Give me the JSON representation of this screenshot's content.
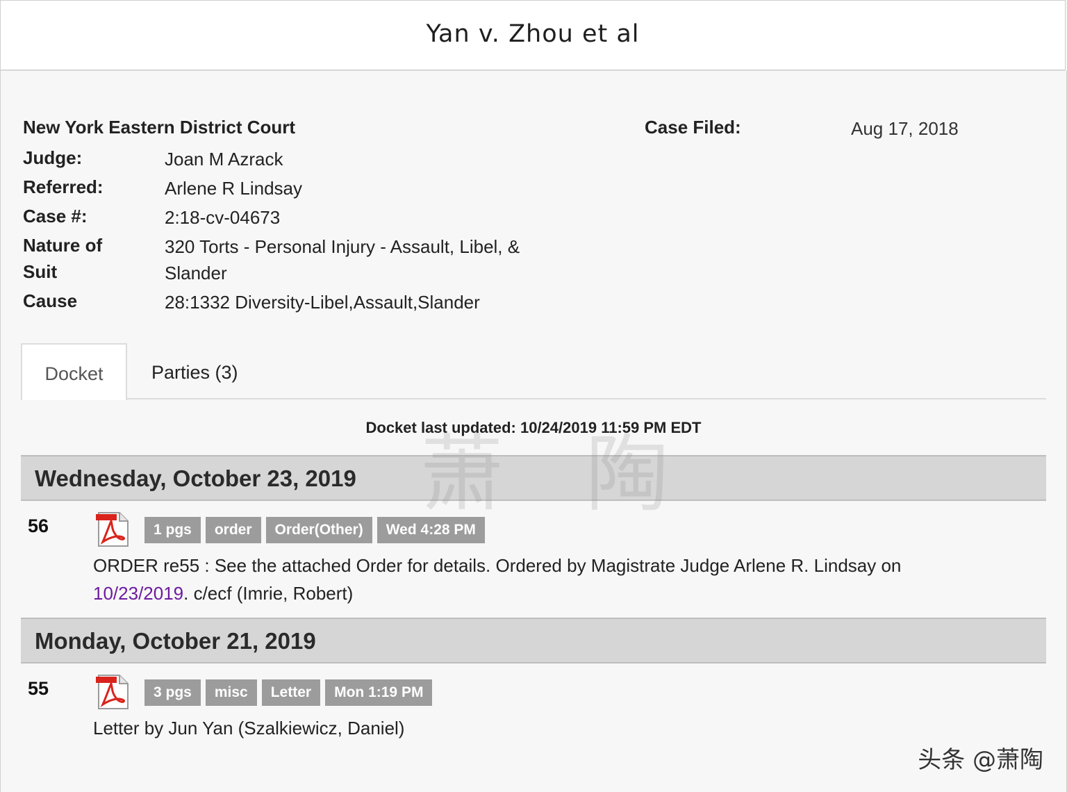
{
  "header": {
    "title": "Yan v. Zhou et al"
  },
  "case": {
    "court": "New York Eastern District Court",
    "fields": [
      {
        "label": "Judge:",
        "value": "Joan M Azrack"
      },
      {
        "label": "Referred:",
        "value": "Arlene R Lindsay"
      },
      {
        "label": "Case #:",
        "value": "2:18-cv-04673"
      },
      {
        "label": "Nature of",
        "label2": "Suit",
        "value": "320 Torts - Personal Injury - Assault, Libel, &",
        "value2": "Slander"
      },
      {
        "label": "Cause",
        "value": "28:1332 Diversity-Libel,Assault,Slander"
      }
    ],
    "filed_label": "Case Filed:",
    "filed_value": "Aug 17, 2018"
  },
  "tabs": [
    {
      "label": "Docket",
      "active": true
    },
    {
      "label": "Parties (3)",
      "active": false
    }
  ],
  "docket": {
    "updated": "Docket last updated: 10/24/2019 11:59 PM EDT",
    "days": [
      {
        "date": "Wednesday, October 23, 2019",
        "entries": [
          {
            "number": "56",
            "icon": "pdf-icon",
            "tags": [
              "1 pgs",
              "order",
              "Order(Other)",
              "Wed 4:28 PM"
            ],
            "text_before": "ORDER re55 : See the attached Order for details. Ordered by Magistrate Judge Arlene R. Lindsay on ",
            "link": "10/23/2019",
            "text_after": ". c/ecf (Imrie, Robert)"
          }
        ]
      },
      {
        "date": "Monday, October 21, 2019",
        "entries": [
          {
            "number": "55",
            "icon": "pdf-icon",
            "tags": [
              "3 pgs",
              "misc",
              "Letter",
              "Mon 1:19 PM"
            ],
            "text": "Letter by Jun Yan (Szalkiewicz, Daniel)"
          }
        ]
      }
    ]
  },
  "overlay": {
    "watermark": "萧 陶",
    "brand": "头条 @萧陶"
  },
  "colors": {
    "day_bar": "#d6d6d6",
    "tag_bg": "#9c9c9c",
    "link": "#6d1aa0",
    "pdf_red": "#d9241c"
  }
}
